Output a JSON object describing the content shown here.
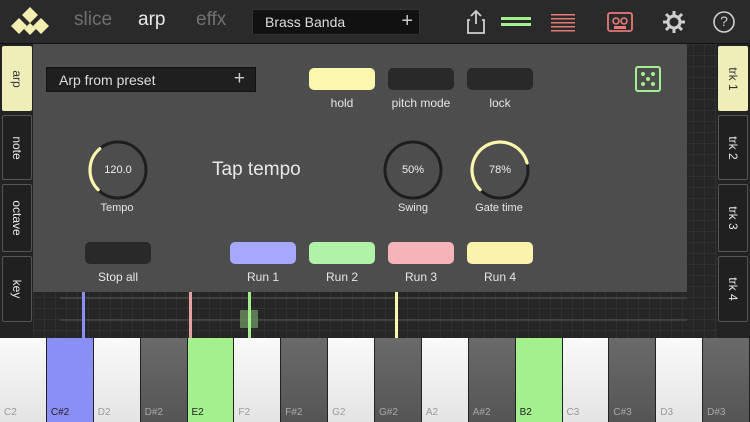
{
  "header": {
    "tabs": [
      {
        "label": "slice",
        "active": false
      },
      {
        "label": "arp",
        "active": true
      },
      {
        "label": "effx",
        "active": false
      }
    ],
    "preset": {
      "name": "Brass Banda",
      "add_symbol": "+"
    },
    "icons": [
      "share-icon",
      "tracks-icon",
      "mixer-lines-icon",
      "tape-icon",
      "gear-icon",
      "help-icon"
    ],
    "help_symbol": "?"
  },
  "left_tabs": [
    {
      "label": "arp",
      "active": true
    },
    {
      "label": "note",
      "active": false
    },
    {
      "label": "octave",
      "active": false
    },
    {
      "label": "key",
      "active": false
    }
  ],
  "right_tabs": [
    {
      "label": "trk 1",
      "active": true
    },
    {
      "label": "trk 2",
      "active": false
    },
    {
      "label": "trk 3",
      "active": false
    },
    {
      "label": "trk 4",
      "active": false
    }
  ],
  "arp": {
    "preset_label": "Arp from preset",
    "preset_add": "+",
    "toggles": {
      "hold": "hold",
      "pitch_mode": "pitch mode",
      "lock": "lock"
    },
    "tempo": {
      "value": "120.0",
      "label": "Tempo",
      "fraction": 0.35
    },
    "tap_tempo": "Tap tempo",
    "swing": {
      "value": "50%",
      "label": "Swing",
      "fraction": 0.0
    },
    "gate": {
      "value": "78%",
      "label": "Gate time",
      "fraction": 0.78
    },
    "stop_all": "Stop all",
    "runs": [
      {
        "label": "Run 1",
        "color": "#a6a8fb"
      },
      {
        "label": "Run 2",
        "color": "#b0f2a8"
      },
      {
        "label": "Run 3",
        "color": "#f4b4b8"
      },
      {
        "label": "Run 4",
        "color": "#fbf3ad"
      }
    ]
  },
  "colors": {
    "accent_yellow": "#fbf7ad",
    "accent_green": "#a5f08e",
    "accent_blue": "#8a8ff5",
    "accent_red": "#e77a78"
  },
  "keyboard": {
    "keys": [
      {
        "label": "C2",
        "type": "white",
        "lit": ""
      },
      {
        "label": "C#2",
        "type": "black",
        "lit": "blue"
      },
      {
        "label": "D2",
        "type": "white",
        "lit": ""
      },
      {
        "label": "D#2",
        "type": "black",
        "lit": ""
      },
      {
        "label": "E2",
        "type": "white",
        "lit": "green"
      },
      {
        "label": "F2",
        "type": "white",
        "lit": ""
      },
      {
        "label": "F#2",
        "type": "black",
        "lit": ""
      },
      {
        "label": "G2",
        "type": "white",
        "lit": ""
      },
      {
        "label": "G#2",
        "type": "black",
        "lit": ""
      },
      {
        "label": "A2",
        "type": "white",
        "lit": ""
      },
      {
        "label": "A#2",
        "type": "black",
        "lit": ""
      },
      {
        "label": "B2",
        "type": "white",
        "lit": "green"
      },
      {
        "label": "C3",
        "type": "white",
        "lit": ""
      },
      {
        "label": "C#3",
        "type": "black",
        "lit": ""
      },
      {
        "label": "D3",
        "type": "white",
        "lit": ""
      },
      {
        "label": "D#3",
        "type": "black",
        "lit": ""
      }
    ]
  }
}
